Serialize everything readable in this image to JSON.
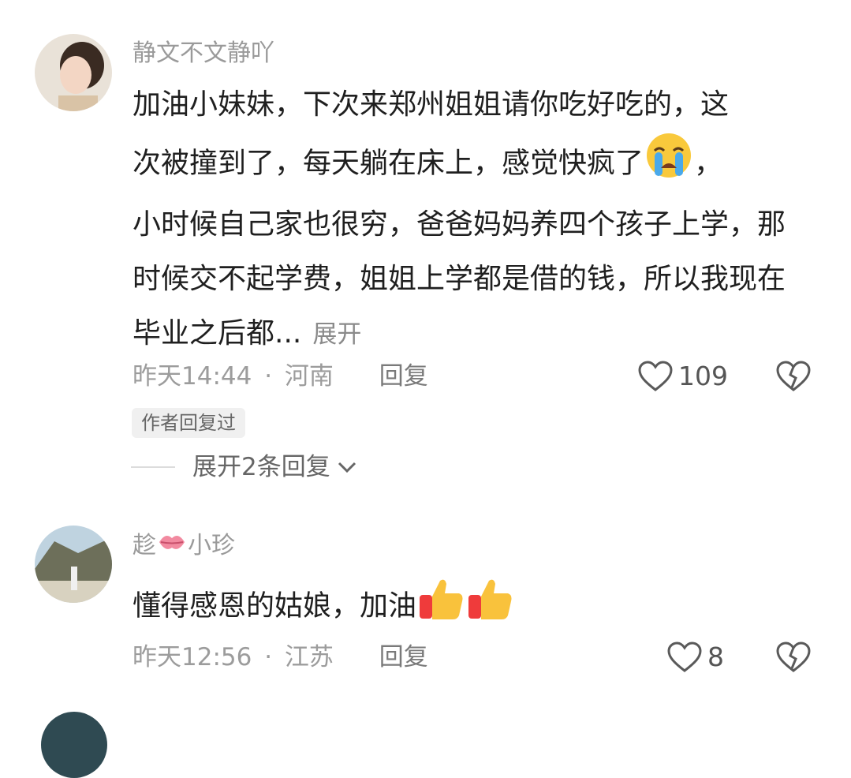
{
  "comments": [
    {
      "username": "静文不文静吖",
      "text_line1": "加油小妹妹，下次来郑州姐姐请你吃好吃的，这",
      "text_line2": "次被撞到了，每天躺在床上，感觉快疯了",
      "text_line2_end": "，",
      "text_rest": "小时候自己家也很穷，爸爸妈妈养四个孩子上学，那时候交不起学费，姐姐上学都是借的钱，所以我现在毕业之后都...",
      "expand_label": "展开",
      "time": "昨天14:44",
      "separator": "·",
      "location": "河南",
      "reply_label": "回复",
      "likes": "109",
      "author_badge": "作者回复过",
      "expand_replies_label": "展开2条回复",
      "emoji_icon": "loudly-crying-face-icon"
    },
    {
      "username_prefix": "趁",
      "username_suffix": "小珍",
      "text": "懂得感恩的姑娘，加油",
      "time": "昨天12:56",
      "separator": "·",
      "location": "江苏",
      "reply_label": "回复",
      "likes": "8",
      "emoji_icons": [
        "thumbs-up-icon",
        "thumbs-up-icon"
      ],
      "name_emoji": "kiss-lips-icon"
    }
  ],
  "colors": {
    "text_primary": "#1f1f1f",
    "text_secondary": "#9c9c9c",
    "badge_bg": "#f0f0f0"
  }
}
